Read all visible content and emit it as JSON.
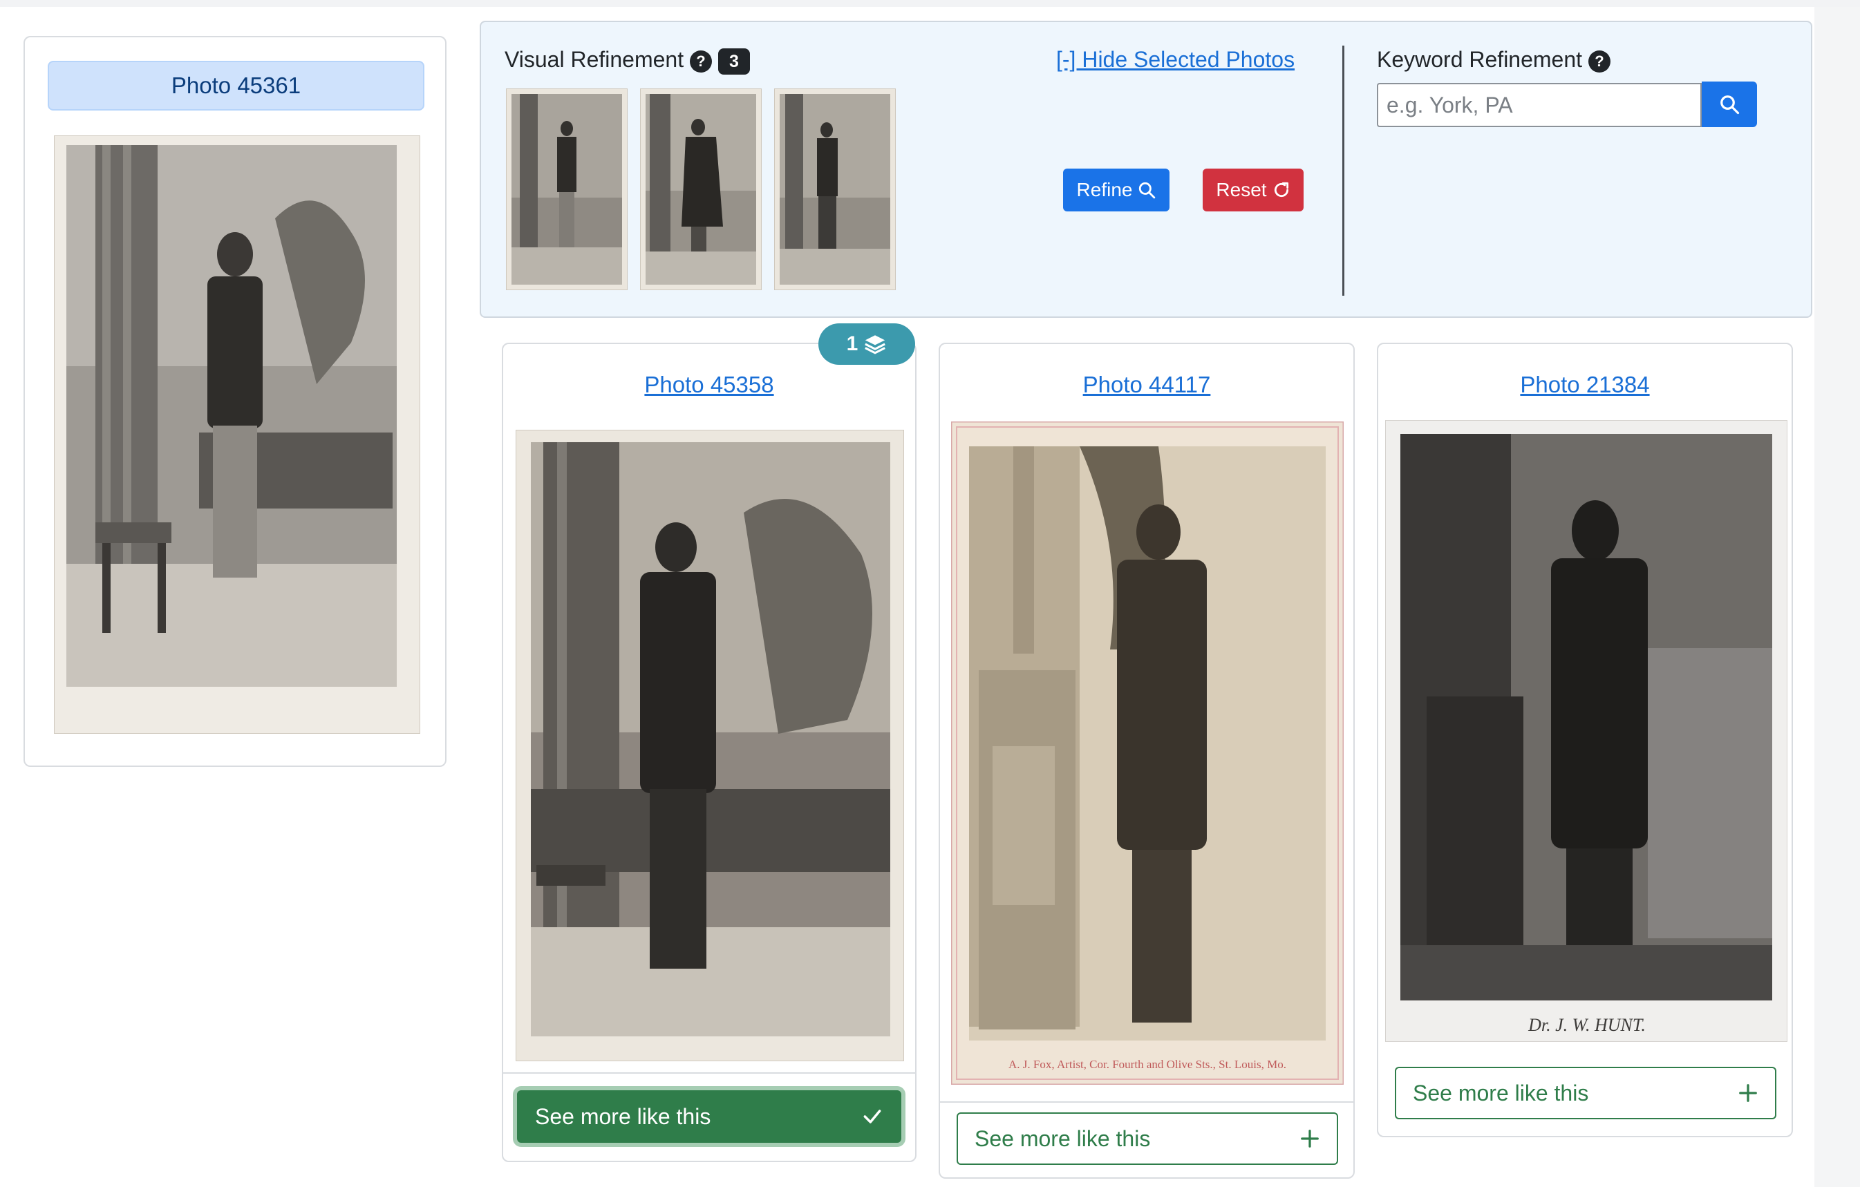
{
  "selected": {
    "title": "Photo 45361"
  },
  "refinement": {
    "visual_label": "Visual Refinement",
    "selected_count": "3",
    "hide_link": "[-] Hide Selected Photos",
    "refine_label": "Refine",
    "reset_label": "Reset",
    "keyword_label": "Keyword Refinement",
    "keyword_placeholder": "e.g. York, PA",
    "keyword_value": ""
  },
  "results": [
    {
      "title": "Photo 45358",
      "button": "See more like this",
      "selected": true,
      "stack_count": "1"
    },
    {
      "title": "Photo 44117",
      "button": "See more like this",
      "selected": false
    },
    {
      "title": "Photo 21384",
      "button": "See more like this",
      "selected": false,
      "caption": "Dr. J. W. HUNT."
    }
  ],
  "photo_44117_imprint": "A. J. Fox, Artist, Cor. Fourth and Olive Sts., St. Louis, Mo.",
  "colors": {
    "link": "#1a6fd6",
    "primary": "#1a73e8",
    "danger": "#d1323f",
    "success": "#2f7d4a",
    "badge": "#3c9aad"
  }
}
